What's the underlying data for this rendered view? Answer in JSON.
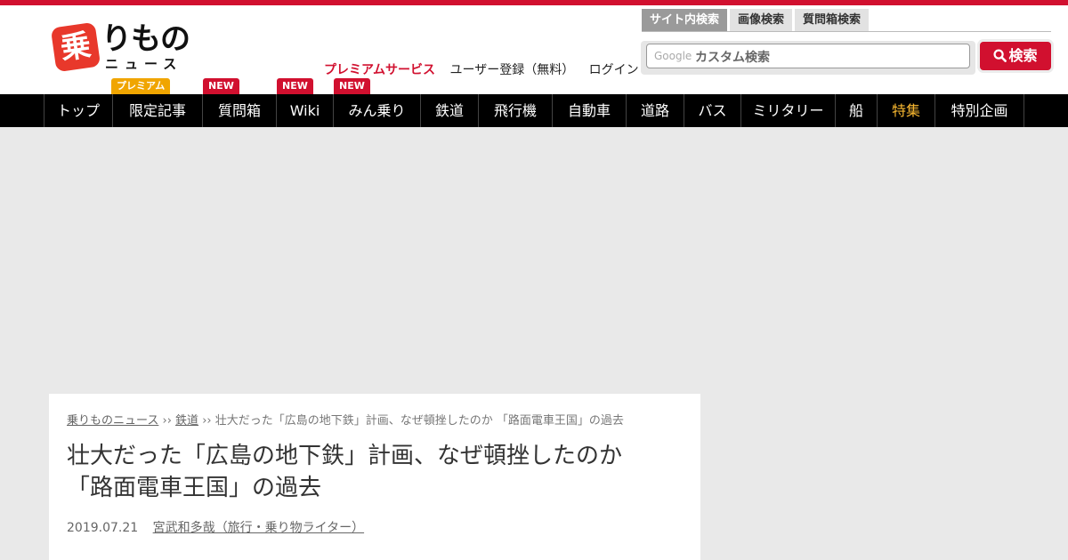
{
  "logo": {
    "badge": "乗",
    "main": "りもの",
    "sub": "ニュース"
  },
  "user_links": {
    "premium": "プレミアムサービス",
    "register": "ユーザー登録（無料）",
    "login": "ログイン"
  },
  "search": {
    "tabs": [
      "サイト内検索",
      "画像検索",
      "質問箱検索"
    ],
    "google_label": "Google",
    "placeholder": "カスタム検索",
    "button": "検索"
  },
  "nav": {
    "items": [
      "トップ",
      "限定記事",
      "質問箱",
      "Wiki",
      "みん乗り",
      "鉄道",
      "飛行機",
      "自動車",
      "道路",
      "バス",
      "ミリタリー",
      "船",
      "特集",
      "特別企画"
    ],
    "badges": {
      "premium": "プレミアム",
      "new": "NEW"
    }
  },
  "article": {
    "breadcrumb": {
      "home": "乗りものニュース",
      "sep": "››",
      "category": "鉄道",
      "current": "壮大だった「広島の地下鉄」計画、なぜ頓挫したのか 「路面電車王国」の過去"
    },
    "title_line1": "壮大だった「広島の地下鉄」計画、なぜ頓挫したのか",
    "title_line2": "「路面電車王国」の過去",
    "date": "2019.07.21",
    "author": "宮武和多哉（旅行・乗り物ライター）"
  },
  "colors": {
    "brand": "#d1102f",
    "nav_bg": "#000000",
    "feature": "#f7b731",
    "premium_badge": "#f0a500"
  }
}
